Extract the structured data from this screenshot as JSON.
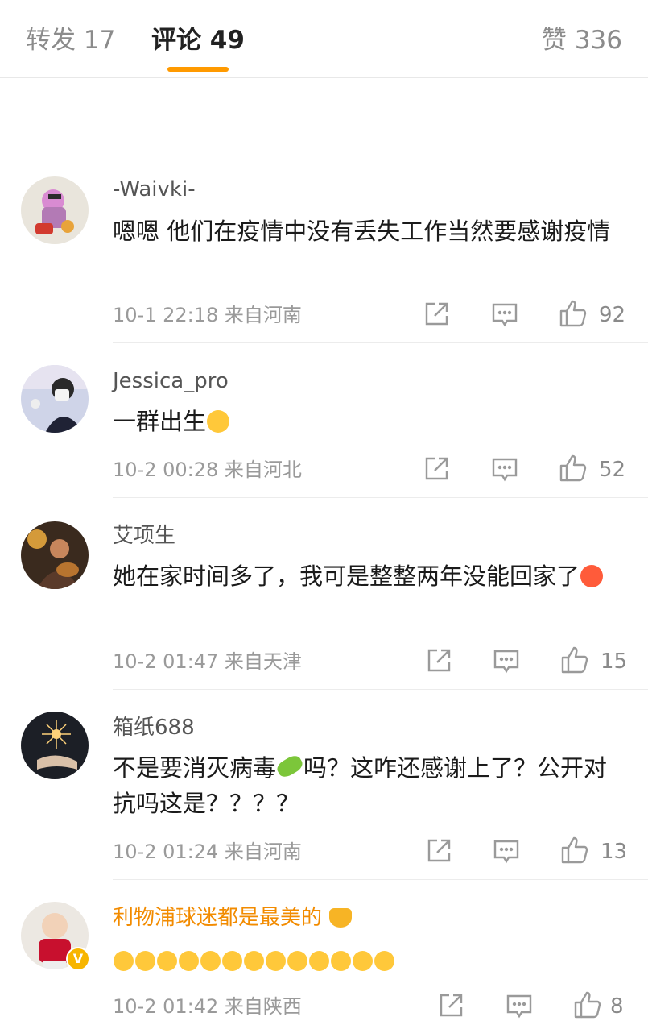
{
  "tabs": {
    "repost": "转发 17",
    "comments": "评论 49",
    "likes": "赞 336"
  },
  "colors": {
    "accent": "#ff9a00",
    "vip_name": "#f28b00",
    "badge": "#f7b500"
  },
  "comments": [
    {
      "username": "-Waivki-",
      "text": "嗯嗯 他们在疫情中没有丢失工作当然要感谢疫情",
      "emojis": [],
      "time": "10-1 22:18",
      "location": "来自河南",
      "likes": "92"
    },
    {
      "username": "Jessica_pro",
      "text": "一群出生",
      "emojis": [
        "blush-emoji"
      ],
      "time": "10-2 00:28",
      "location": "来自河北",
      "likes": "52"
    },
    {
      "username": "艾项生",
      "text": "她在家时间多了，我可是整整两年没能回家了",
      "emojis": [
        "angry-emoji"
      ],
      "time": "10-2 01:47",
      "location": "来自天津",
      "likes": "15"
    },
    {
      "username": "箱纸688",
      "text_before": "不是要消灭病毒",
      "text_after": "吗？这咋还感谢上了？公开对抗吗这是？？？？",
      "emojis": [
        "virus-emoji"
      ],
      "time": "10-2 01:24",
      "location": "来自河南",
      "likes": "13"
    },
    {
      "username": "利物浦球迷都是最美的",
      "text": "",
      "emojis": [
        "crown-emoji",
        "crying-emoji x13"
      ],
      "badge": "V",
      "time": "10-2 01:42",
      "location": "来自陕西",
      "likes": "8"
    }
  ]
}
